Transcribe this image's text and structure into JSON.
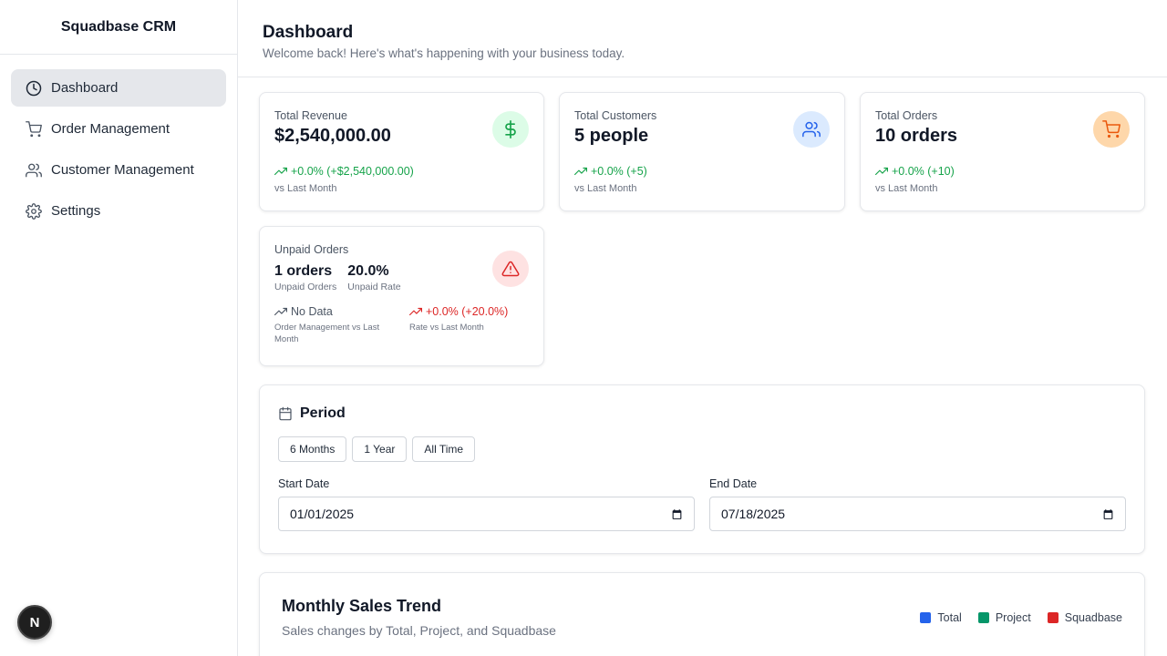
{
  "sidebar": {
    "brand": "Squadbase CRM",
    "items": [
      {
        "label": "Dashboard",
        "icon": "clock-icon",
        "active": true
      },
      {
        "label": "Order Management",
        "icon": "cart-icon"
      },
      {
        "label": "Customer Management",
        "icon": "users-icon"
      },
      {
        "label": "Settings",
        "icon": "gear-icon"
      }
    ],
    "badge": "N"
  },
  "header": {
    "title": "Dashboard",
    "subtitle": "Welcome back! Here's what's happening with your business today."
  },
  "stats": {
    "revenue": {
      "label": "Total Revenue",
      "value": "$2,540,000.00",
      "trend": "+0.0% (+$2,540,000.00)",
      "sub": "vs Last Month",
      "icon": "dollar-icon",
      "color": "#16a34a"
    },
    "customers": {
      "label": "Total Customers",
      "value": "5 people",
      "trend": "+0.0% (+5)",
      "sub": "vs Last Month",
      "icon": "users-icon",
      "color": "#2563eb"
    },
    "orders": {
      "label": "Total Orders",
      "value": "10 orders",
      "trend": "+0.0% (+10)",
      "sub": "vs Last Month",
      "icon": "cart-icon",
      "color": "#ea580c"
    },
    "unpaid": {
      "label": "Unpaid Orders",
      "count_value": "1 orders",
      "count_label": "Unpaid Orders",
      "rate_value": "20.0%",
      "rate_label": "Unpaid Rate",
      "trend_left": "No Data",
      "trend_left_sub": "Order Management vs Last Month",
      "trend_right": "+0.0% (+20.0%)",
      "trend_right_sub": "Rate vs Last Month",
      "icon": "warning-icon",
      "color": "#dc2626"
    }
  },
  "period": {
    "title": "Period",
    "buttons": [
      "6 Months",
      "1 Year",
      "All Time"
    ],
    "start_label": "Start Date",
    "start_value": "01/01/2025",
    "end_label": "End Date",
    "end_value": "07/18/2025"
  },
  "trend_chart": {
    "title": "Monthly Sales Trend",
    "subtitle": "Sales changes by Total, Project, and Squadbase",
    "legend": [
      {
        "name": "Total",
        "color": "#2563eb"
      },
      {
        "name": "Project",
        "color": "#059669"
      },
      {
        "name": "Squadbase",
        "color": "#dc2626"
      }
    ]
  }
}
